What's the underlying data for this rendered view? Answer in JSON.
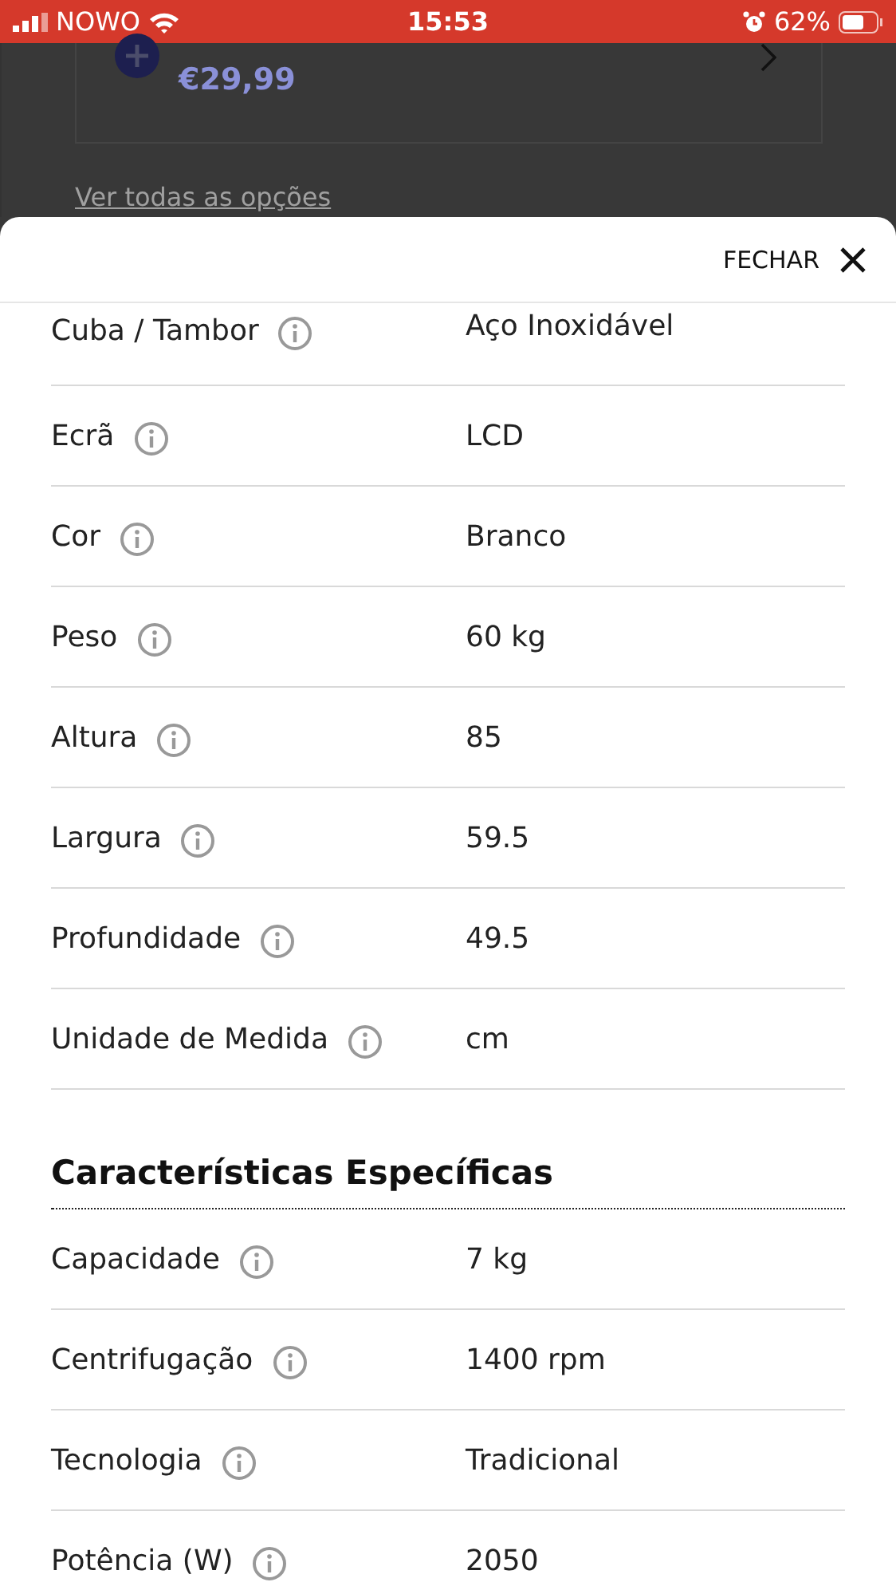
{
  "status_bar": {
    "carrier": "NOWO",
    "time": "15:53",
    "battery": "62%"
  },
  "background": {
    "price": "€29,99",
    "link": "Ver todas as opções"
  },
  "sheet": {
    "close_label": "FECHAR",
    "sections": [
      {
        "rows": [
          {
            "label": "Cuba / Tambor",
            "value": "Aço Inoxidável"
          },
          {
            "label": "Ecrã",
            "value": "LCD"
          },
          {
            "label": "Cor",
            "value": "Branco"
          },
          {
            "label": "Peso",
            "value": "60 kg"
          },
          {
            "label": "Altura",
            "value": "85"
          },
          {
            "label": "Largura",
            "value": "59.5"
          },
          {
            "label": "Profundidade",
            "value": "49.5"
          },
          {
            "label": "Unidade de Medida",
            "value": "cm"
          }
        ]
      },
      {
        "title": "Características Específicas",
        "rows": [
          {
            "label": "Capacidade",
            "value": "7 kg"
          },
          {
            "label": "Centrifugação",
            "value": "1400 rpm"
          },
          {
            "label": "Tecnologia",
            "value": "Tradicional"
          },
          {
            "label": "Potência (W)",
            "value": "2050"
          }
        ]
      }
    ]
  }
}
